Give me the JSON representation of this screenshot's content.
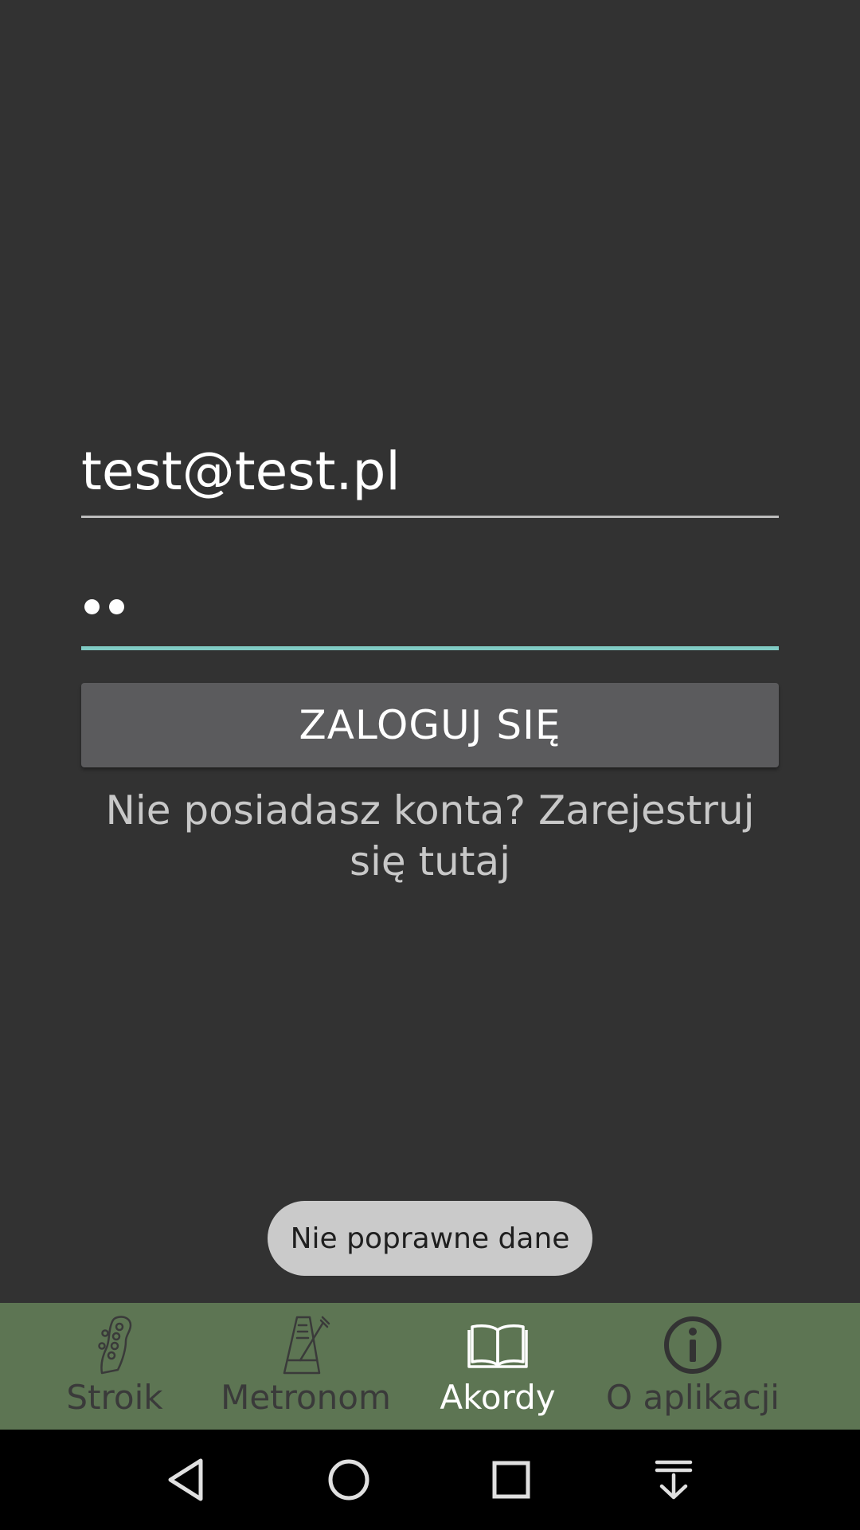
{
  "login": {
    "email_value": "test@test.pl",
    "password_mask_count": 2,
    "login_button_label": "ZALOGUJ SIĘ",
    "register_prompt": "Nie posiadasz konta? Zarejestruj się tutaj"
  },
  "toast": {
    "message": "Nie poprawne dane"
  },
  "bottom_nav": {
    "items": [
      {
        "label": "Stroik",
        "icon": "guitar-headstock-icon",
        "active": false
      },
      {
        "label": "Metronom",
        "icon": "metronome-icon",
        "active": false
      },
      {
        "label": "Akordy",
        "icon": "book-icon",
        "active": true
      },
      {
        "label": "O aplikacji",
        "icon": "info-icon",
        "active": false
      }
    ],
    "background_color": "#5d7553",
    "active_color": "#ffffff",
    "inactive_color": "#3a3a3a"
  },
  "system_nav": {
    "buttons": [
      "back-icon",
      "home-icon",
      "recents-icon",
      "notification-pulldown-icon"
    ]
  },
  "colors": {
    "background": "#323232",
    "accent_underline": "#80cbc4",
    "button_bg": "#5b5b5d"
  }
}
